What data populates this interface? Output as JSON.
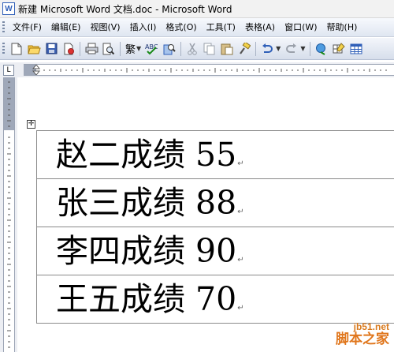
{
  "window": {
    "title": "新建 Microsoft Word 文档.doc - Microsoft Word"
  },
  "menu": {
    "items": [
      "文件(F)",
      "编辑(E)",
      "视图(V)",
      "插入(I)",
      "格式(O)",
      "工具(T)",
      "表格(A)",
      "窗口(W)",
      "帮助(H)"
    ]
  },
  "toolbar": {
    "icons": [
      "new-icon",
      "open-icon",
      "save-icon",
      "permission-icon",
      "print-icon",
      "print-preview-icon",
      "traditional-chinese-icon",
      "spelling-icon",
      "research-icon",
      "cut-icon",
      "copy-icon",
      "paste-icon",
      "format-painter-icon",
      "undo-icon",
      "redo-icon",
      "hyperlink-icon",
      "tables-borders-icon",
      "insert-table-icon"
    ],
    "traditional_label": "繁"
  },
  "ruler": {
    "corner_label": "L"
  },
  "table": {
    "rows": [
      {
        "text": "赵二成绩 55"
      },
      {
        "text": "张三成绩 88"
      },
      {
        "text": "李四成绩 90"
      },
      {
        "text": "王五成绩 70"
      }
    ]
  },
  "watermark": {
    "line1": "jb51.net",
    "line2": "脚本之家"
  },
  "colors": {
    "accent": "#2f5fb8",
    "watermark": "#e0761c"
  }
}
